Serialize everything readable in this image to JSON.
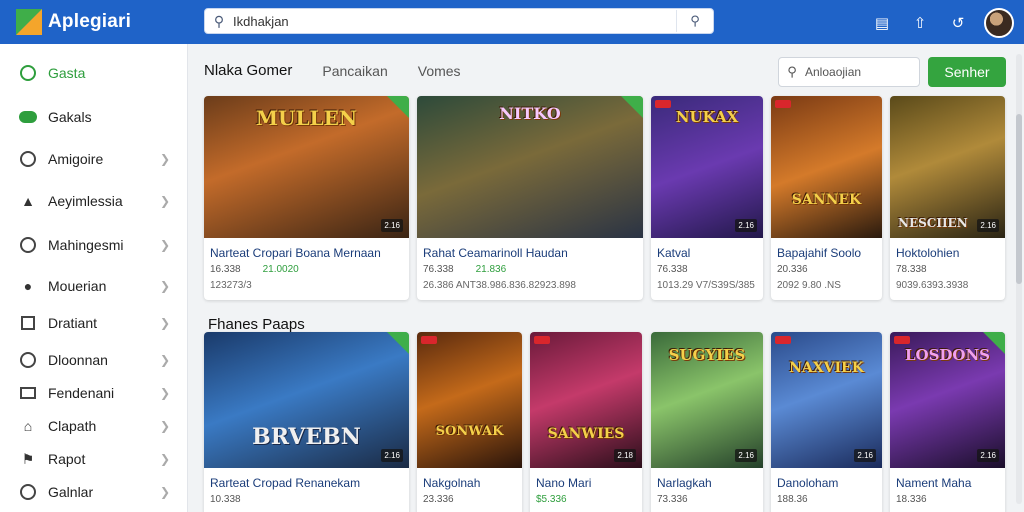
{
  "app": {
    "title": "Aplegiari"
  },
  "search": {
    "placeholder": "",
    "value": "Ikdhakjan",
    "icon": "search-icon"
  },
  "colors": {
    "topbar": "#1f63c8",
    "accent": "#34a43f",
    "link": "#1b3d7a"
  },
  "sidebar": {
    "items": [
      {
        "label": "Gasta",
        "icon": "circle-icon",
        "active": true
      },
      {
        "label": "Gakals",
        "icon": "cloud-icon"
      },
      {
        "label": "Amigoire",
        "icon": "circle-icon"
      },
      {
        "label": "Aeyimlessia",
        "icon": "home-icon"
      },
      {
        "label": "Mahingesmi",
        "icon": "circle-icon"
      },
      {
        "label": "Mouerian",
        "icon": "user-icon"
      },
      {
        "label": "Dratiant",
        "icon": "square-icon"
      },
      {
        "label": "Dloonnan",
        "icon": "circle-icon"
      },
      {
        "label": "Fendenani",
        "icon": "card-icon"
      },
      {
        "label": "Clapath",
        "icon": "home-icon"
      },
      {
        "label": "Rapot",
        "icon": "flag-icon"
      },
      {
        "label": "Galnlar",
        "icon": "circle-icon"
      }
    ]
  },
  "tabs": [
    "Nlaka Gomer",
    "Pancaikan",
    "Vomes"
  ],
  "filter": {
    "value": "Anloaojian"
  },
  "cta": {
    "label": "Senher"
  },
  "section2": {
    "title": "Fhanes Paaps"
  },
  "row1": [
    {
      "title": "Narteat Cropari Boana Mernaan",
      "meta1": "16.338",
      "price": "21.0020",
      "meta2": "123273/3",
      "art_text": "MULLEN",
      "size": "2.16"
    },
    {
      "title": "Rahat Ceamarinoll Haudan",
      "meta1": "76.338",
      "price": "21.836",
      "meta2": "26.386 ANT38.986.836.82923.898",
      "art_text": "NITKO",
      "size": ""
    },
    {
      "title": "Katval",
      "meta1": "76.338",
      "price": "",
      "meta2": "1013.29 V7/S39S/385",
      "art_text": "NUKAX",
      "size": "2.16"
    },
    {
      "title": "Bapajahif Soolo",
      "meta1": "20.336",
      "price": "",
      "meta2": "2092 9.80 .NS",
      "art_text": "SANNEK",
      "size": ""
    },
    {
      "title": "Hoktolohien",
      "meta1": "78.338",
      "price": "",
      "meta2": "9039.6393.3938",
      "art_text": "NESCIIEN",
      "size": "2.16"
    }
  ],
  "row2": [
    {
      "title": "Rarteat Cropad Renanekam",
      "meta1": "10.338",
      "price": "",
      "meta2": "",
      "art_text": "BRVEBN",
      "size": "2.16"
    },
    {
      "title": "Nakgolnah",
      "meta1": "23.336",
      "price": "",
      "meta2": "",
      "art_text": "SONWAK",
      "size": ""
    },
    {
      "title": "Nano Mari",
      "meta1": "$5.336",
      "price": "",
      "meta2": "",
      "art_text": "SANWIES",
      "size": "2.18"
    },
    {
      "title": "Narlagkah",
      "meta1": "73.336",
      "price": "",
      "meta2": "",
      "art_text": "SUGYIES",
      "size": "2.16"
    },
    {
      "title": "Danoloham",
      "meta1": "188.36",
      "price": "",
      "meta2": "",
      "art_text": "NAXVIEK",
      "size": "2.16"
    },
    {
      "title": "Nament Maha",
      "meta1": "18.336",
      "price": "",
      "meta2": "",
      "art_text": "LOSDONS",
      "size": "2.16"
    }
  ]
}
